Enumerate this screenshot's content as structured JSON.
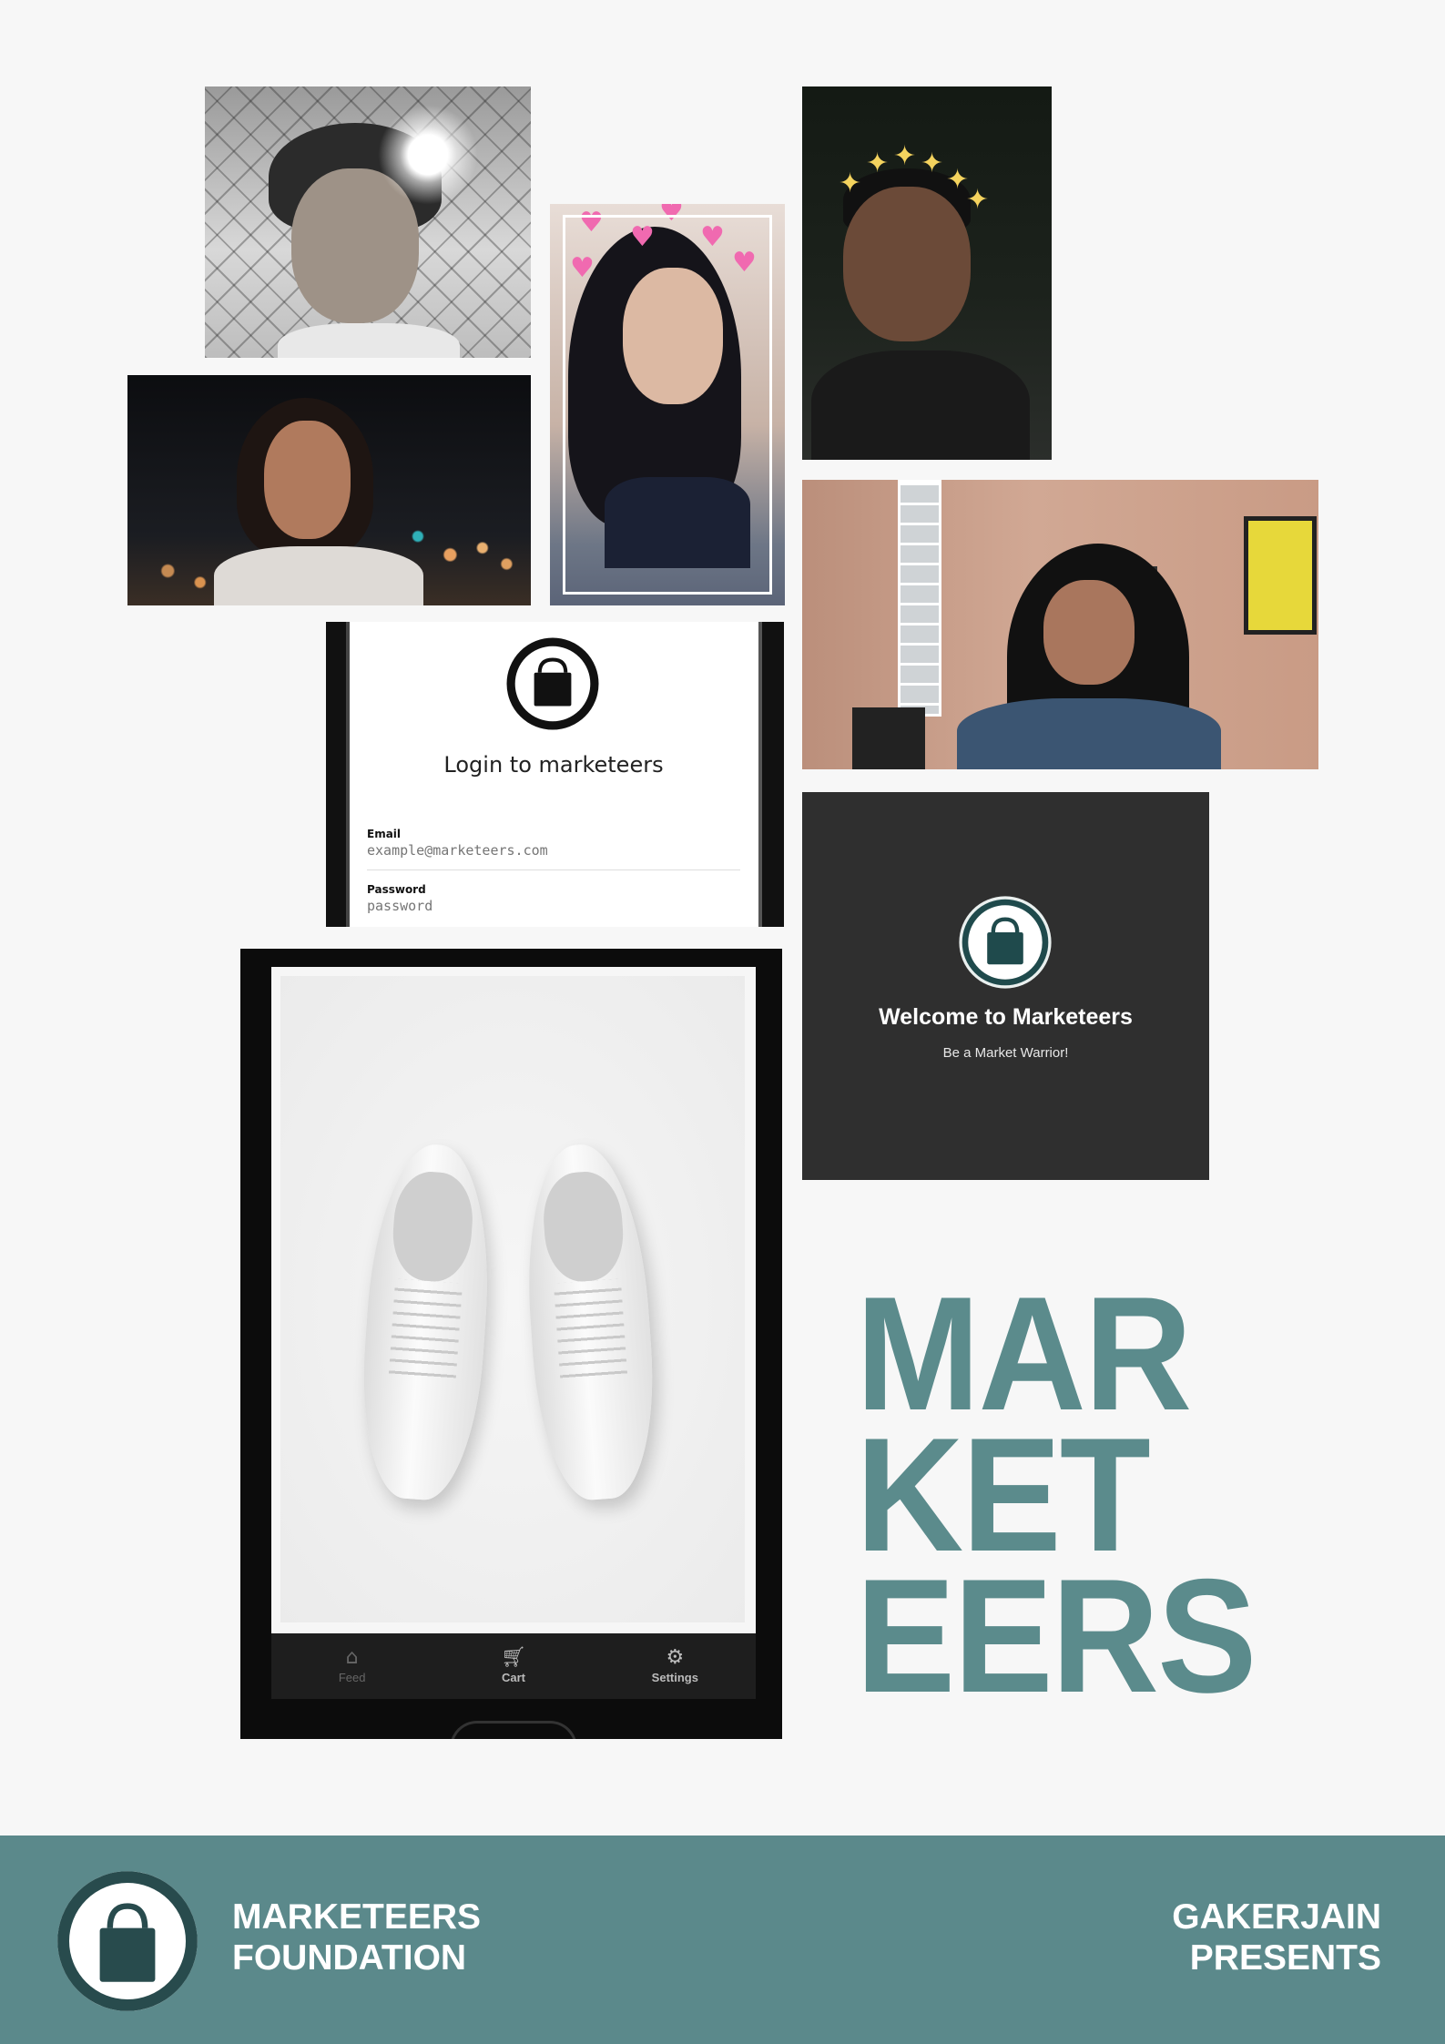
{
  "colors": {
    "background": "#f7f7f7",
    "brand_teal": "#5b898b",
    "title_teal": "#5b8b8c",
    "dark_card": "#2f2f2f"
  },
  "login_screen": {
    "title": "Login to marketeers",
    "email_label": "Email",
    "email_placeholder": "example@marketeers.com",
    "password_label": "Password",
    "password_placeholder": "password",
    "logo_icon": "shopping-bag-icon"
  },
  "welcome_screen": {
    "title": "Welcome to Marketeers",
    "subtitle": "Be a Market Warrior!",
    "logo_icon": "shopping-bag-icon"
  },
  "shop_screen": {
    "tabs": [
      {
        "label": "Feed",
        "icon": "home-icon",
        "active": false
      },
      {
        "label": "Cart",
        "icon": "cart-icon",
        "active": true
      },
      {
        "label": "Settings",
        "icon": "settings-icon",
        "active": true
      }
    ]
  },
  "poster_title": [
    "MAR",
    "KET",
    "EERS"
  ],
  "footer": {
    "left_line1": "MARKETEERS",
    "left_line2": "FOUNDATION",
    "right_line1": "GAKERJAIN",
    "right_line2": "PRESENTS",
    "logo_icon": "shopping-bag-icon"
  }
}
